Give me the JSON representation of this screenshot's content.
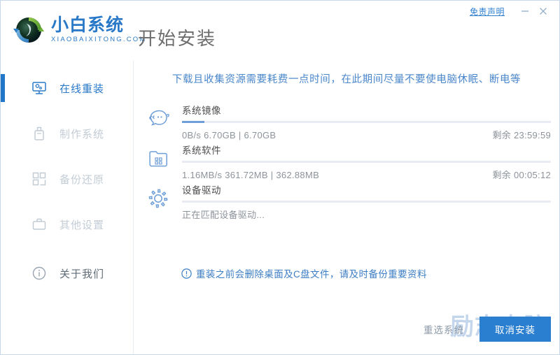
{
  "titlebar": {
    "disclaimer_label": "免责声明",
    "minimize_icon": "minimize-icon",
    "close_icon": "close-icon"
  },
  "header": {
    "logo_cn": "小白系统",
    "logo_en": "XIAOBAIXITONG.COM",
    "page_title": "开始安装"
  },
  "sidebar": {
    "items": [
      {
        "label": "在线重装",
        "icon": "monitor-icon",
        "active": true
      },
      {
        "label": "制作系统",
        "icon": "usb-drive-icon",
        "active": false
      },
      {
        "label": "备份还原",
        "icon": "blocks-icon",
        "active": false
      },
      {
        "label": "其他设置",
        "icon": "briefcase-icon",
        "active": false
      },
      {
        "label": "关于我们",
        "icon": "info-circle-icon",
        "active": false
      }
    ]
  },
  "main": {
    "notice": "下载且收集资源需要耗费一点时间，在此期间尽量不要使电脑休眠、断电等",
    "tasks": [
      {
        "name": "系统镜像",
        "icon": "ghost-cloud-icon",
        "progress_percent": 6,
        "meta": "0B/s 6.70GB | 6.70GB",
        "remaining": "剩余 23:59:59"
      },
      {
        "name": "系统软件",
        "icon": "folder-apps-icon",
        "progress_percent": 0,
        "meta": "1.16MB/s 361.72MB | 362.88MB",
        "remaining": "剩余 00:05:12"
      },
      {
        "name": "设备驱动",
        "icon": "gear-icon",
        "progress_percent": 0,
        "meta": "正在匹配设备驱动...",
        "remaining": ""
      }
    ],
    "warning": {
      "icon": "exclamation-circle-icon",
      "text": "重装之前会删除桌面及C盘文件，请及时备份重要资料"
    }
  },
  "footer": {
    "reselect_label": "重选系统",
    "cancel_label": "取消安装",
    "watermark": "励志电脑"
  },
  "colors": {
    "accent": "#2b7fd0",
    "notice_text": "#4a87cb",
    "muted_text": "#c3ccd5",
    "progress_fill": "#6f9fd8",
    "progress_track": "#e8ecf2"
  }
}
